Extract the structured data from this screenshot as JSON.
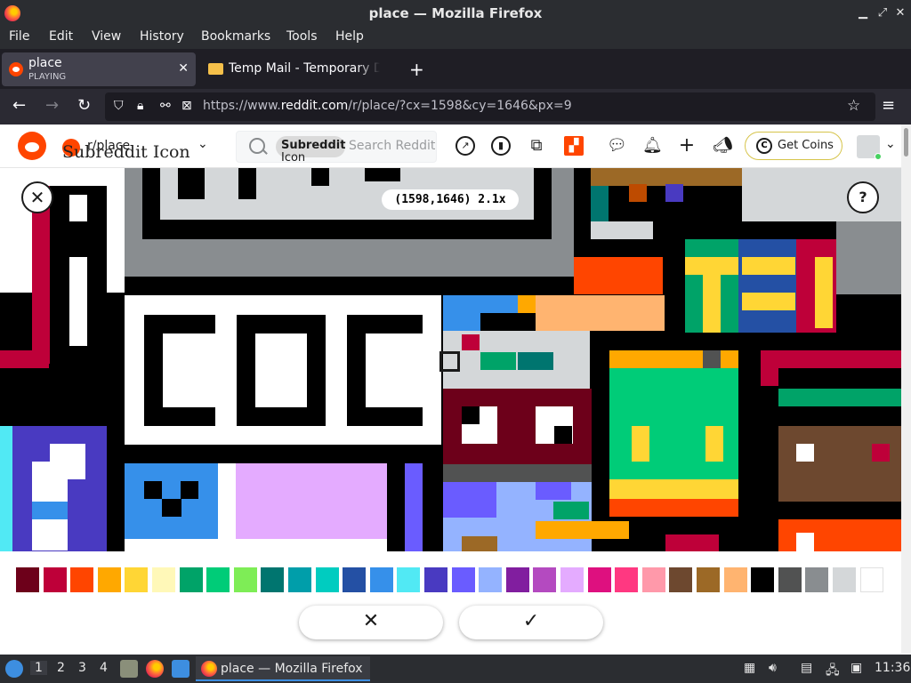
{
  "window": {
    "title": "place — Mozilla Firefox"
  },
  "menu": [
    "File",
    "Edit",
    "View",
    "History",
    "Bookmarks",
    "Tools",
    "Help"
  ],
  "tabs": [
    {
      "title": "place",
      "subtitle": "PLAYING",
      "active": true
    },
    {
      "title": "Temp Mail - Temporary Disposable Email",
      "active": false
    }
  ],
  "url": {
    "prefix": "https://www.",
    "domain": "reddit.com",
    "path": "/r/place/?cx=1598&cy=1646&px=9"
  },
  "reddit": {
    "subreddit": "r/place",
    "subreddit_icon_alt": "Subreddit Icon",
    "search_chip": "Subreddit",
    "search_chip_alt": "Icon",
    "search_placeholder": "Search Reddit",
    "coins_label": "Get Coins",
    "coins_glyph": "C"
  },
  "place": {
    "coordinates": "(1598,1646) 2.1x",
    "help_glyph": "?",
    "close_glyph": "✕",
    "confirm_glyph": "✓",
    "cancel_glyph": "✕",
    "palette": [
      "#6d001a",
      "#be0039",
      "#ff4500",
      "#ffa800",
      "#ffd635",
      "#fff8b8",
      "#00a368",
      "#00cc78",
      "#7eed56",
      "#00756f",
      "#009eaa",
      "#00ccc0",
      "#2450a4",
      "#3690ea",
      "#51e9f4",
      "#493ac1",
      "#6a5cff",
      "#94b3ff",
      "#811e9f",
      "#b44ac0",
      "#e4abff",
      "#de107f",
      "#ff3881",
      "#ff99aa",
      "#6d482f",
      "#9c6926",
      "#ffb470",
      "#000000",
      "#515252",
      "#898d90",
      "#d4d7d9",
      "#ffffff"
    ]
  },
  "taskbar": {
    "workspaces": [
      "1",
      "2",
      "3",
      "4"
    ],
    "task_title": "place — Mozilla Firefox",
    "clock": "11:36"
  }
}
